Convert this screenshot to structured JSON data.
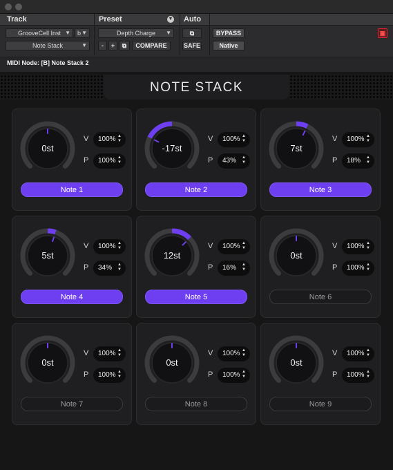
{
  "colors": {
    "accent": "#6e3ff0",
    "inactive": "#1b1b1d",
    "track": "#3c3c3e"
  },
  "header": {
    "track_label": "Track",
    "preset_label": "Preset",
    "auto_label": "Auto",
    "track_select": "GrooveCell Inst",
    "track_letter": "b",
    "insert_select": "Note Stack",
    "preset_select": "Depth Charge",
    "minus_label": "-",
    "plus_label": "+",
    "compare_label": "COMPARE",
    "bypass_label": "BYPASS",
    "safe_label": "SAFE",
    "native_label": "Native",
    "midi_node": "MIDI Node: [B] Note Stack 2"
  },
  "plugin": {
    "title": "NOTE STACK"
  },
  "notes": [
    {
      "label": "Note 1",
      "semitones": "0st",
      "value": 0,
      "v": "100%",
      "p": "100%",
      "active": true
    },
    {
      "label": "Note 2",
      "semitones": "-17st",
      "value": -17,
      "v": "100%",
      "p": "43%",
      "active": true
    },
    {
      "label": "Note 3",
      "semitones": "7st",
      "value": 7,
      "v": "100%",
      "p": "18%",
      "active": true
    },
    {
      "label": "Note 4",
      "semitones": "5st",
      "value": 5,
      "v": "100%",
      "p": "34%",
      "active": true
    },
    {
      "label": "Note 5",
      "semitones": "12st",
      "value": 12,
      "v": "100%",
      "p": "16%",
      "active": true
    },
    {
      "label": "Note 6",
      "semitones": "0st",
      "value": 0,
      "v": "100%",
      "p": "100%",
      "active": false
    },
    {
      "label": "Note 7",
      "semitones": "0st",
      "value": 0,
      "v": "100%",
      "p": "100%",
      "active": false
    },
    {
      "label": "Note 8",
      "semitones": "0st",
      "value": 0,
      "v": "100%",
      "p": "100%",
      "active": false
    },
    {
      "label": "Note 9",
      "semitones": "0st",
      "value": 0,
      "v": "100%",
      "p": "100%",
      "active": false
    }
  ],
  "knob_range": 36,
  "v_label": "V",
  "p_label": "P"
}
